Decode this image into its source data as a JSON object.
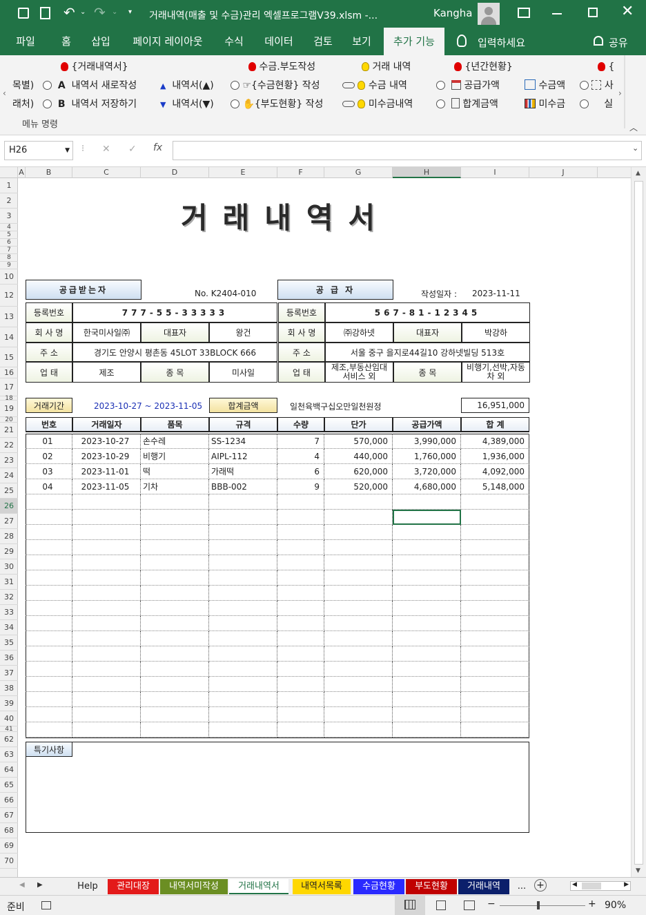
{
  "window": {
    "title": "거래내역(매출 및 수금)관리 엑셀프로그램V39.xlsm  -...",
    "user": "Kangha"
  },
  "tabs": [
    "파일",
    "홈",
    "삽입",
    "페이지 레이아웃",
    "수식",
    "데이터",
    "검토",
    "보기",
    "추가 기능"
  ],
  "tell_me": "입력하세요",
  "share": "공유",
  "ribbon": {
    "row1": [
      "{거래내역서}",
      "수금.부도작성",
      "거래 내역",
      "{년간현황}",
      "{"
    ],
    "row2": [
      "목별)",
      "A",
      "내역서 새로작성",
      "내역서(▲)",
      "{수금현황} 작성",
      "수금 내역",
      "공급가액",
      "수금액",
      "사"
    ],
    "row3": [
      "래처)",
      "B",
      "내역서 저장하기",
      "내역서(▼)",
      "{부도현황} 작성",
      "미수금내역",
      "합계금액",
      "미수금",
      "실"
    ],
    "group": "메뉴 명령"
  },
  "formula": {
    "namebox": "H26",
    "value": ""
  },
  "columns": [
    "A",
    "B",
    "C",
    "D",
    "E",
    "F",
    "G",
    "H",
    "I",
    "J"
  ],
  "rows": [
    "1",
    "2",
    "3",
    "4",
    "5",
    "6",
    "7",
    "8",
    "9",
    "10",
    "12",
    "13",
    "14",
    "15",
    "16",
    "17",
    "18",
    "19",
    "20",
    "21",
    "22",
    "23",
    "24",
    "25",
    "26",
    "27",
    "28",
    "29",
    "30",
    "31",
    "32",
    "33",
    "34",
    "35",
    "36",
    "37",
    "38",
    "39",
    "40",
    "41",
    "62",
    "63",
    "64",
    "65",
    "66",
    "67",
    "68",
    "69",
    "70"
  ],
  "doc": {
    "title": "거래내역서",
    "recv_hdr": "공급받는자",
    "doc_no": "No. K2404-010",
    "supp_hdr": "공  급  자",
    "date_lbl": "작성일자 :",
    "date": "2023-11-11",
    "lbl_reg": "등록번호",
    "lbl_co": "회 사 명",
    "lbl_ceo": "대표자",
    "lbl_addr": "주    소",
    "lbl_biz": "업    태",
    "lbl_item": "종    목",
    "recv": {
      "reg": "777-55-33333",
      "co": "한국미사일㈜",
      "ceo": "왕건",
      "addr": "경기도 안양시 평촌동 45LOT 33BLOCK 666",
      "biz": "제조",
      "item": "미사일"
    },
    "supp": {
      "reg": "567-81-12345",
      "co": "㈜강하넷",
      "ceo": "박강하",
      "addr": "서울 중구 을지로44길10 강하넷빌딩 513호",
      "biz1": "제조,부동산임대",
      "biz2": "서비스 외",
      "item1": "비행기,선박,자동",
      "item2": "차 외"
    },
    "period_lbl": "거래기간",
    "period": "2023-10-27 ~ 2023-11-05",
    "sum_lbl": "합계금액",
    "sum_text": "일천육백구십오만일천원정",
    "sum": "16,951,000",
    "headers": [
      "번호",
      "거래일자",
      "품목",
      "규격",
      "수량",
      "단가",
      "공급가액",
      "합  계"
    ],
    "items": [
      [
        "01",
        "2023-10-27",
        "손수레",
        "SS-1234",
        "7",
        "570,000",
        "3,990,000",
        "4,389,000"
      ],
      [
        "02",
        "2023-10-29",
        "비행기",
        "AIPL-112",
        "4",
        "440,000",
        "1,760,000",
        "1,936,000"
      ],
      [
        "03",
        "2023-11-01",
        "떡",
        "가래떡",
        "6",
        "620,000",
        "3,720,000",
        "4,092,000"
      ],
      [
        "04",
        "2023-11-05",
        "기차",
        "BBB-002",
        "9",
        "520,000",
        "4,680,000",
        "5,148,000"
      ]
    ],
    "note_lbl": "특기사항"
  },
  "sheet_tabs": [
    "Help",
    "관리대장",
    "내역서미작성",
    "거래내역서",
    "내역서목록",
    "수금현황",
    "부도현황",
    "거래내역",
    "..."
  ],
  "sheet_tab_colors": [
    "#f0f0f0",
    "#e31a1a",
    "#6b8e23",
    "#ffffff",
    "#ffd700",
    "#2a2aff",
    "#c00000",
    "#0b1f6b",
    "#f0f0f0"
  ],
  "status": {
    "ready": "준비",
    "zoom": "90%"
  }
}
